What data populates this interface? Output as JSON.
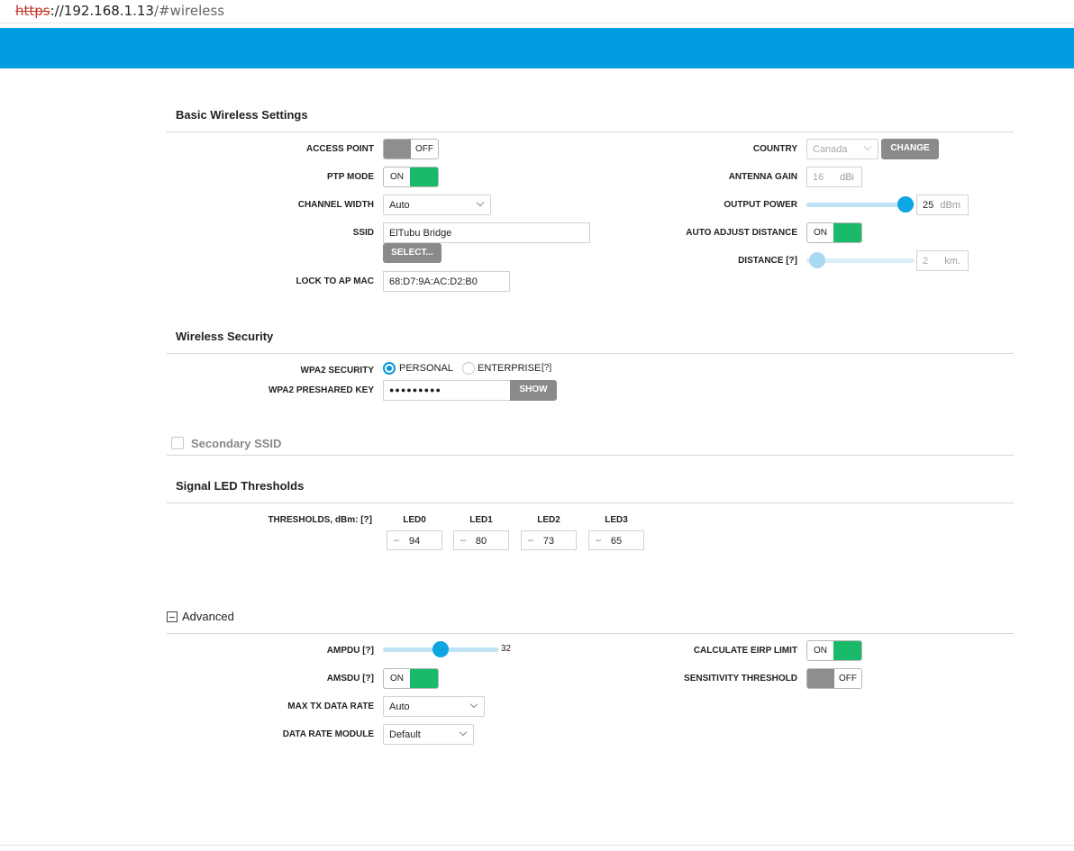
{
  "browser": {
    "url_scheme": "https",
    "url_rest_host": "://192.168.1.13",
    "url_path": "/#wireless"
  },
  "basic": {
    "title": "Basic Wireless Settings",
    "access_point": {
      "label": "ACCESS POINT",
      "state": "OFF"
    },
    "ptp_mode": {
      "label": "PTP MODE",
      "state": "ON"
    },
    "channel_width": {
      "label": "CHANNEL WIDTH",
      "value": "Auto"
    },
    "ssid": {
      "label": "SSID",
      "value": "ElTubu Bridge",
      "select_button": "SELECT..."
    },
    "lock_to_ap_mac": {
      "label": "LOCK TO AP MAC",
      "value": "68:D7:9A:AC:D2:B0"
    },
    "country": {
      "label": "COUNTRY",
      "value": "Canada",
      "change_button": "CHANGE"
    },
    "antenna_gain": {
      "label": "ANTENNA GAIN",
      "value": "16",
      "unit": "dBi"
    },
    "output_power": {
      "label": "OUTPUT POWER",
      "value": "25",
      "unit": "dBm",
      "level": 0.92
    },
    "auto_adjust_distance": {
      "label": "AUTO ADJUST DISTANCE",
      "state": "ON"
    },
    "distance": {
      "label": "DISTANCE [?]",
      "value": "2",
      "unit": "km.",
      "level": 0.1
    }
  },
  "security": {
    "title": "Wireless Security",
    "wpa2_security": {
      "label": "WPA2 SECURITY",
      "option_personal": "PERSONAL",
      "option_enterprise": "ENTERPRISE",
      "help": "[?]",
      "selected": "PERSONAL"
    },
    "preshared_key": {
      "label": "WPA2 PRESHARED KEY",
      "value": "●●●●●●●●●",
      "show_button": "SHOW"
    }
  },
  "secondary_ssid": {
    "title": "Secondary SSID"
  },
  "led": {
    "title": "Signal LED Thresholds",
    "label": "THRESHOLDS, dBm: [?]",
    "items": [
      {
        "name": "LED0",
        "sign": "–",
        "value": "94"
      },
      {
        "name": "LED1",
        "sign": "–",
        "value": "80"
      },
      {
        "name": "LED2",
        "sign": "–",
        "value": "73"
      },
      {
        "name": "LED3",
        "sign": "–",
        "value": "65"
      }
    ]
  },
  "advanced": {
    "title": "Advanced",
    "ampdu": {
      "label": "AMPDU [?]",
      "value": "32",
      "level": 0.5
    },
    "amsdu": {
      "label": "AMSDU [?]",
      "state": "ON"
    },
    "max_tx_data_rate": {
      "label": "MAX TX DATA RATE",
      "value": "Auto"
    },
    "data_rate_module": {
      "label": "DATA RATE MODULE",
      "value": "Default"
    },
    "calculate_eirp_limit": {
      "label": "CALCULATE EIRP LIMIT",
      "state": "ON"
    },
    "sensitivity_threshold": {
      "label": "SENSITIVITY THRESHOLD",
      "state": "OFF"
    }
  },
  "colors": {
    "banner": "#009de0",
    "toggle_on": "#19bb6b",
    "toggle_off": "#8e8e8e",
    "slider": "#0ea5e4"
  }
}
